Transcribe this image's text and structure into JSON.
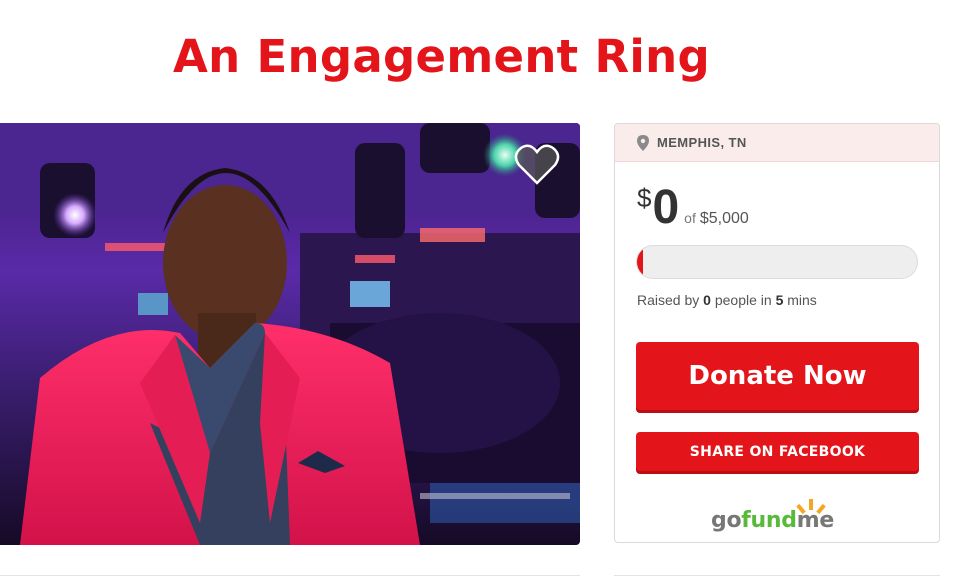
{
  "campaign": {
    "title": "An Engagement Ring"
  },
  "photo": {
    "alt": "Man in red blazer at a nightclub"
  },
  "favorite": {
    "icon": "heart-icon"
  },
  "sidebar": {
    "location_icon": "map-pin-icon",
    "location": "MEMPHIS, TN",
    "currency": "$",
    "amount": "0",
    "of_label": "of",
    "goal": "$5,000",
    "progress": 0.02,
    "raised_prefix": "Raised by",
    "people_count": "0",
    "people_label": "people in",
    "time_value": "5",
    "time_unit": "mins",
    "donate_label": "Donate Now",
    "share_label": "SHARE ON FACEBOOK",
    "logo": {
      "go": "go",
      "fund": "fund",
      "me": "me"
    }
  },
  "colors": {
    "brand_red": "#e3151a",
    "gofundme_green": "#58b93b",
    "logo_orange": "#f6a623"
  }
}
